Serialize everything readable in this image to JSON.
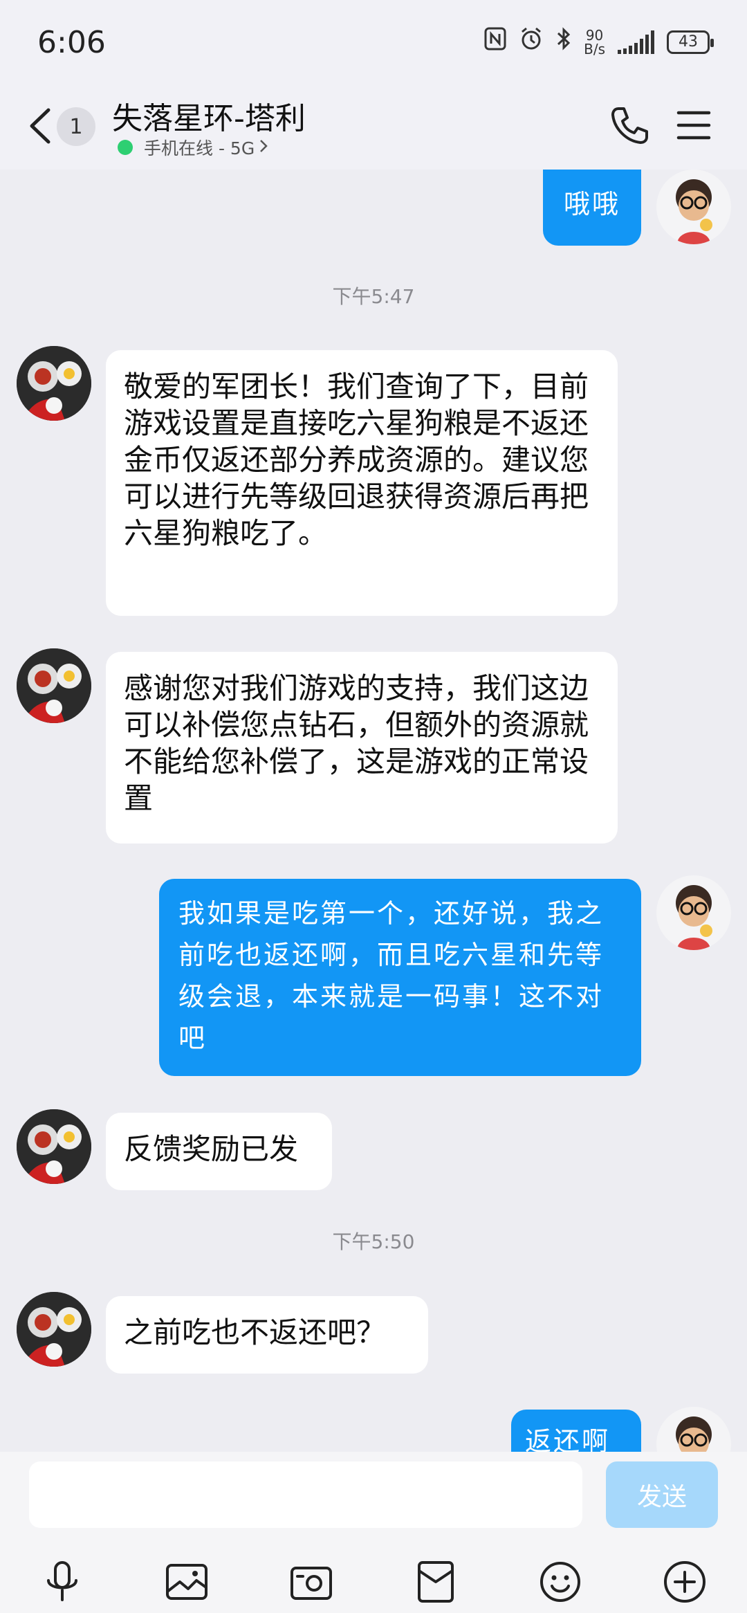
{
  "status_bar": {
    "time": "6:06",
    "net_speed_value": "90",
    "net_speed_unit": "B/s",
    "battery": "43"
  },
  "header": {
    "back_badge": "1",
    "title": "失落星环-塔利",
    "subtitle": "手机在线 - 5G"
  },
  "messages": [
    {
      "side": "out",
      "text": "哦哦"
    },
    {
      "type": "time",
      "text": "下午5:47"
    },
    {
      "side": "in",
      "text": "敬爱的军团长！我们查询了下，目前游戏设置是直接吃六星狗粮是不返还金币仅返还部分养成资源的。建议您可以进行先等级回退获得资源后再把六星狗粮吃了。"
    },
    {
      "side": "in",
      "text": "感谢您对我们游戏的支持，我们这边可以补偿您点钻石，但额外的资源就不能给您补偿了，这是游戏的正常设置"
    },
    {
      "side": "out",
      "text": "我如果是吃第一个，还好说，我之前吃也返还啊，而且吃六星和先等级会退，本来就是一码事！这不对吧"
    },
    {
      "side": "in",
      "text": "反馈奖励已发"
    },
    {
      "type": "time",
      "text": "下午5:50"
    },
    {
      "side": "in",
      "text": "之前吃也不返还吧？"
    },
    {
      "side": "out",
      "text": "返还啊"
    }
  ],
  "input": {
    "value": "",
    "send_label": "发送"
  },
  "colors": {
    "outgoing_bubble": "#1296f5",
    "incoming_bubble": "#ffffff",
    "online": "#2ecf72",
    "send_disabled": "#a6d8fb"
  },
  "icons": {
    "toolbar": [
      "microphone-icon",
      "image-icon",
      "camera-icon",
      "red-packet-icon",
      "emoji-icon",
      "plus-icon"
    ]
  }
}
